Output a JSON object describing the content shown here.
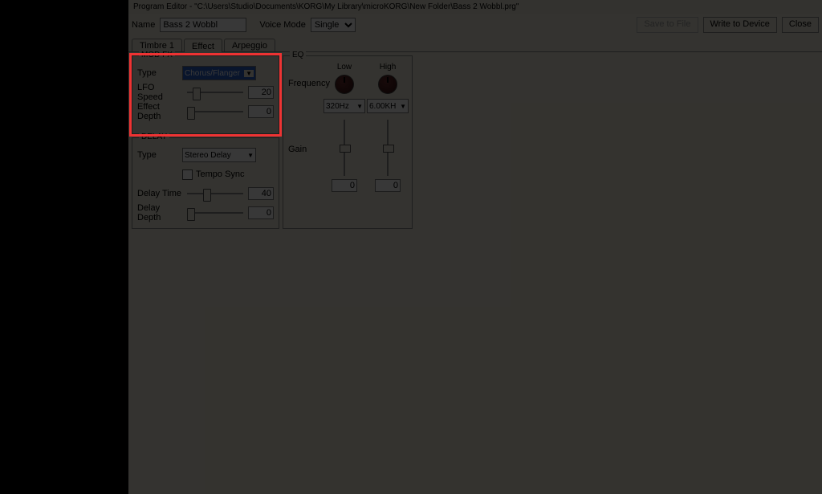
{
  "window": {
    "title": "Program Editor - \"C:\\Users\\Studio\\Documents\\KORG\\My Library\\microKORG\\New Folder\\Bass 2 Wobbl.prg\""
  },
  "toolbar": {
    "name_label": "Name",
    "name_value": "Bass 2 Wobbl",
    "voice_mode_label": "Voice Mode",
    "voice_mode_value": "Single",
    "save_to_file": "Save to File",
    "write_to_device": "Write to Device",
    "close": "Close"
  },
  "tabs": [
    "Timbre 1",
    "Effect",
    "Arpeggio"
  ],
  "modfx": {
    "title": "MOD FX",
    "type_label": "Type",
    "type_value": "Chorus/Flanger",
    "lfo_speed_label": "LFO Speed",
    "lfo_speed_value": "20",
    "effect_depth_label": "Effect Depth",
    "effect_depth_value": "0"
  },
  "delay": {
    "title": "DELAY",
    "type_label": "Type",
    "type_value": "Stereo Delay",
    "tempo_sync_label": "Tempo Sync",
    "delay_time_label": "Delay Time",
    "delay_time_value": "40",
    "delay_depth_label": "Delay Depth",
    "delay_depth_value": "0"
  },
  "eq": {
    "title": "EQ",
    "frequency_label": "Frequency",
    "gain_label": "Gain",
    "low_label": "Low",
    "high_label": "High",
    "low_freq": "320Hz",
    "high_freq": "6.00KH",
    "low_gain": "0",
    "high_gain": "0"
  }
}
